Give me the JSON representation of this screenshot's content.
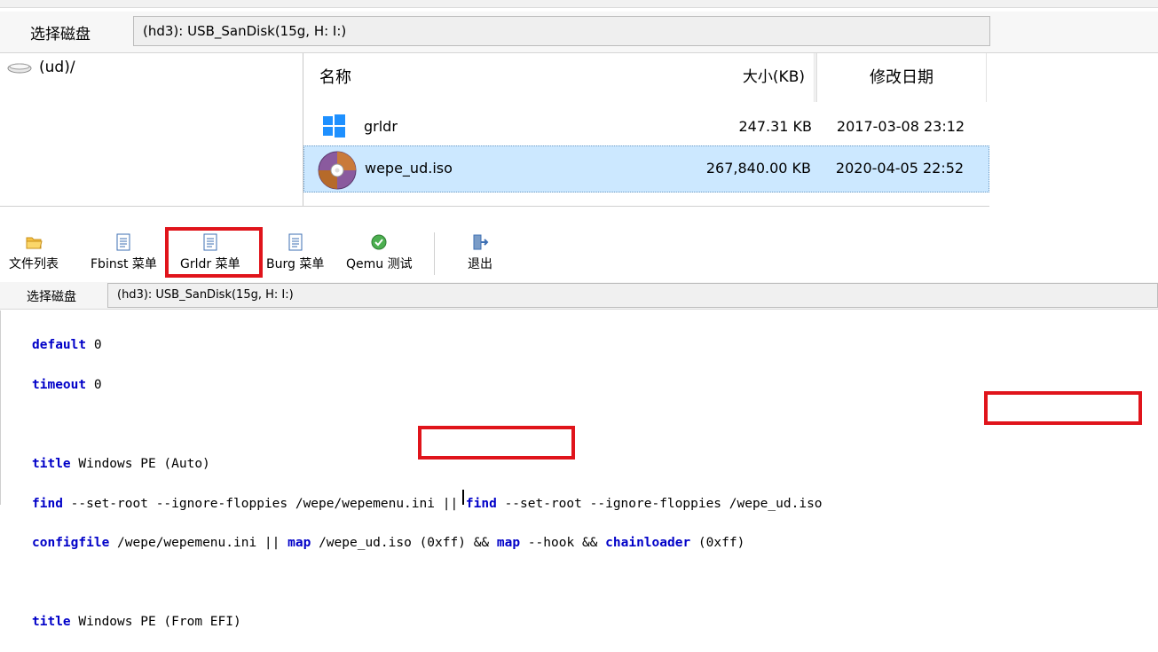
{
  "top_panel": {
    "disk_label": "选择磁盘",
    "disk_value": "(hd3): USB_SanDisk(15g, H: I:)",
    "tree": [
      {
        "label": "(ud)/",
        "icon": "drive-icon"
      }
    ],
    "list": {
      "columns": {
        "name": "名称",
        "size": "大小(KB)",
        "date": "修改日期"
      },
      "rows": [
        {
          "name": "grldr",
          "size": "247.31 KB",
          "date": "2017-03-08 23:12",
          "icon": "windows-icon",
          "selected": false
        },
        {
          "name": "wepe_ud.iso",
          "size": "267,840.00 KB",
          "date": "2020-04-05 22:52",
          "icon": "disc-icon",
          "selected": true
        }
      ]
    }
  },
  "toolbar": {
    "buttons": [
      {
        "label": "文件列表",
        "icon": "folder-icon"
      },
      {
        "label": "Fbinst 菜单",
        "icon": "document-icon"
      },
      {
        "label": "Grldr 菜单",
        "icon": "document-icon",
        "highlighted": true
      },
      {
        "label": "Burg 菜单",
        "icon": "document-icon"
      },
      {
        "label": "Qemu 测试",
        "icon": "qemu-icon"
      },
      {
        "label": "退出",
        "icon": "exit-icon"
      }
    ],
    "disk_label": "选择磁盘",
    "disk_value": "(hd3): USB_SanDisk(15g, H: I:)"
  },
  "editor": {
    "lines": [
      {
        "kw": "default",
        "rest": " 0"
      },
      {
        "kw": "timeout",
        "rest": " 0"
      },
      {
        "kw": "",
        "rest": ""
      },
      {
        "kw": "title",
        "rest": " Windows PE (Auto)"
      },
      {
        "raw": "find --set-root --ignore-floppies /wepe/wepemenu.ini || find --set-root --ignore-floppies /wepe_ud.iso"
      },
      {
        "raw": "configfile /wepe/wepemenu.ini || map /wepe_ud.iso (0xff) && map --hook && chainloader (0xff)"
      },
      {
        "kw": "",
        "rest": ""
      },
      {
        "kw": "title",
        "rest": " Windows PE (From EFI)"
      }
    ]
  },
  "colors": {
    "highlight_box": "#e0141b",
    "keyword": "#0000c8",
    "selection": "#cce8ff"
  }
}
